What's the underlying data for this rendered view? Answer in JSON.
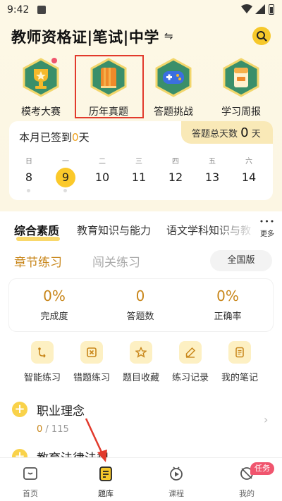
{
  "status_bar": {
    "time": "9:42",
    "notification_icon": "a-icon"
  },
  "header": {
    "title": "教师资格证|笔试|中学",
    "swap_glyph": "⇋",
    "search_icon": "search-icon"
  },
  "quick_entries": [
    {
      "label": "模考大赛",
      "icon": "trophy-icon",
      "has_dot": true
    },
    {
      "label": "历年真题",
      "icon": "book-icon",
      "highlighted": true
    },
    {
      "label": "答题挑战",
      "icon": "gamepad-icon"
    },
    {
      "label": "学习周报",
      "icon": "report-icon"
    }
  ],
  "checkin": {
    "month_prefix": "本月已签到",
    "month_days": "0",
    "month_suffix": "天",
    "total_prefix": "答题总天数",
    "total_days": "0",
    "total_suffix": "天",
    "week": [
      {
        "day": "日",
        "date": "8",
        "dot": true
      },
      {
        "day": "一",
        "date": "9",
        "dot": true,
        "today": true
      },
      {
        "day": "二",
        "date": "10"
      },
      {
        "day": "三",
        "date": "11"
      },
      {
        "day": "四",
        "date": "12"
      },
      {
        "day": "五",
        "date": "13"
      },
      {
        "day": "六",
        "date": "14"
      }
    ]
  },
  "subjects": {
    "tabs": [
      "综合素质",
      "教育知识与能力",
      "语文学科知识与教"
    ],
    "active": 0,
    "more_dots": "•••",
    "more_label": "更多"
  },
  "modes": {
    "tabs": [
      "章节练习",
      "闯关练习"
    ],
    "active": 0,
    "scope_label": "全国版"
  },
  "stats": [
    {
      "value": "0%",
      "label": "完成度"
    },
    {
      "value": "0",
      "label": "答题数"
    },
    {
      "value": "0%",
      "label": "正确率"
    }
  ],
  "tools": [
    {
      "label": "智能练习",
      "icon": "smart-practice-icon"
    },
    {
      "label": "错题练习",
      "icon": "wrong-questions-icon"
    },
    {
      "label": "题目收藏",
      "icon": "star-icon"
    },
    {
      "label": "练习记录",
      "icon": "pencil-icon"
    },
    {
      "label": "我的笔记",
      "icon": "notes-icon"
    }
  ],
  "chapters": [
    {
      "title": "职业理念",
      "done": "0",
      "total": "/ 115"
    },
    {
      "title": "教育法律法规"
    }
  ],
  "bottom_nav": {
    "items": [
      {
        "label": "首页",
        "icon": "home-book-icon"
      },
      {
        "label": "题库",
        "icon": "question-bank-icon",
        "active": true
      },
      {
        "label": "课程",
        "icon": "course-play-icon"
      },
      {
        "label": "我的",
        "icon": "profile-icon"
      }
    ],
    "task_badge": "任务"
  },
  "colors": {
    "accent": "#f6c82b",
    "highlight_box": "#e23a2c",
    "gold_text": "#c8861a",
    "dot": "#f0556e"
  }
}
